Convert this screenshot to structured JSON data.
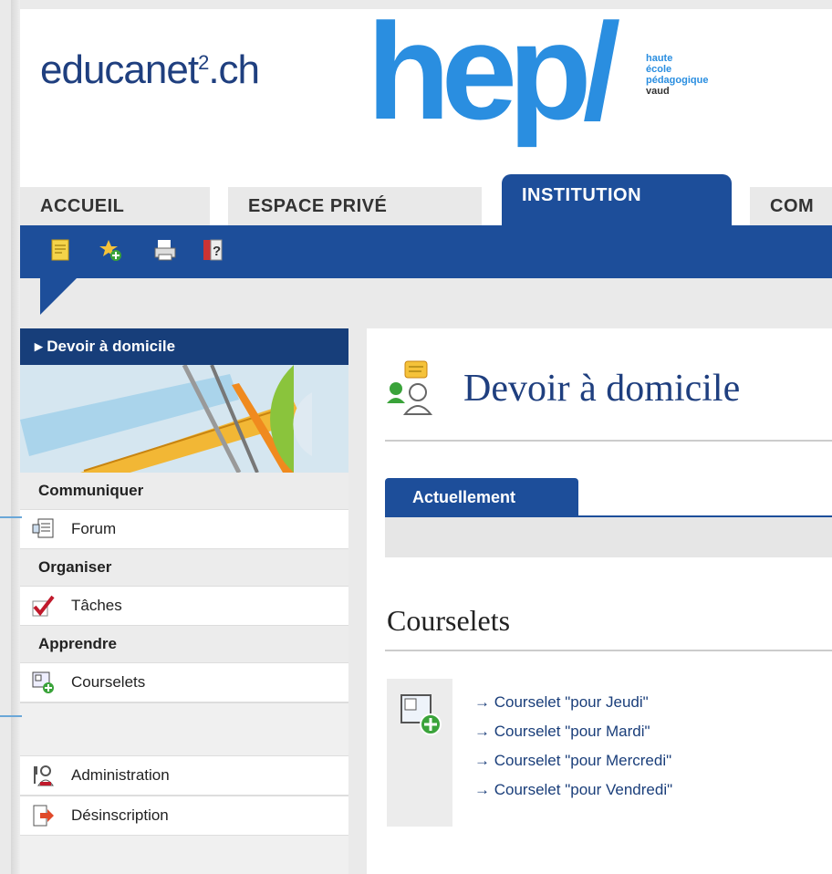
{
  "header": {
    "brand": "educanet",
    "brand_sup": "2",
    "brand_suffix": ".ch",
    "hep_text": "hep/",
    "hep_tagline": [
      "haute",
      "école",
      "pédagogique",
      "vaud"
    ]
  },
  "tabs": [
    {
      "label": "ACCUEIL",
      "active": false
    },
    {
      "label": "ESPACE PRIVÉ",
      "active": false
    },
    {
      "label": "INSTITUTION",
      "active": true
    },
    {
      "label": "COM",
      "active": false
    }
  ],
  "toolbar_icons": [
    "notes-icon",
    "favorite-add-icon",
    "print-icon",
    "help-icon"
  ],
  "sidebar": {
    "title": "Devoir à domicile",
    "sections": [
      {
        "label": "Communiquer",
        "items": [
          {
            "label": "Forum",
            "icon": "forum-icon"
          }
        ]
      },
      {
        "label": "Organiser",
        "items": [
          {
            "label": "Tâches",
            "icon": "tasks-check-icon"
          }
        ]
      },
      {
        "label": "Apprendre",
        "items": [
          {
            "label": "Courselets",
            "icon": "courselet-add-icon"
          }
        ]
      }
    ],
    "admin_items": [
      {
        "label": "Administration",
        "icon": "administration-icon"
      },
      {
        "label": "Désinscription",
        "icon": "unsubscribe-icon"
      }
    ]
  },
  "main": {
    "title": "Devoir à domicile",
    "subtab": "Actuellement",
    "section_title": "Courselets",
    "courselets": [
      "→ Courselet \"pour Jeudi\"",
      "→ Courselet \"pour Mardi\"",
      "→ Courselet \"pour Mercredi\"",
      "→ Courselet \"pour Vendredi\""
    ]
  },
  "colors": {
    "navy": "#1d4e9a",
    "hep_blue": "#2a8ee0",
    "brand_navy": "#1f3f7f"
  }
}
